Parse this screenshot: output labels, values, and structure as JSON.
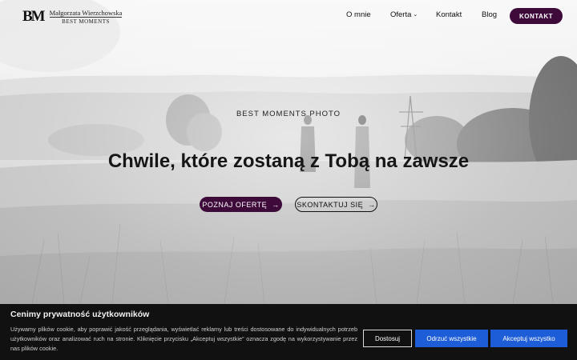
{
  "nav": {
    "logo_mark": "BM",
    "logo_name": "Małgorzata Wierzchowska",
    "logo_sub": "BEST MOMENTS",
    "items": [
      {
        "label": "O mnie"
      },
      {
        "label": "Oferta",
        "chevron": "chevron-down-icon"
      },
      {
        "label": "Kontakt"
      },
      {
        "label": "Blog"
      }
    ],
    "cta_label": "KONTAKT"
  },
  "hero": {
    "eyebrow": "BEST MOMENTS PHOTO",
    "headline": "Chwile, które zostaną z Tobą na zawsze",
    "primary_label": "POZNAJ OFERTĘ",
    "secondary_label": "SKONTAKTUJ SIĘ",
    "arrow_glyph": "→"
  },
  "cookie": {
    "title": "Cenimy prywatność użytkowników",
    "text": "Używamy plików cookie, aby poprawić jakość przeglądania, wyświetlać reklamy lub treści dostosowane do indywidualnych potrzeb użytkowników oraz analizować ruch na stronie. Kliknięcie przycisku „Akceptuj wszystkie” oznacza zgodę na wykorzystywanie przez nas plików cookie.",
    "customize_label": "Dostosuj",
    "reject_label": "Odrzuć wszystkie",
    "accept_label": "Akceptuj wszystko"
  },
  "colors": {
    "brand_plum": "#3d0a3a",
    "cookie_bg": "#111111",
    "cookie_button_blue": "#1d5ed8"
  }
}
